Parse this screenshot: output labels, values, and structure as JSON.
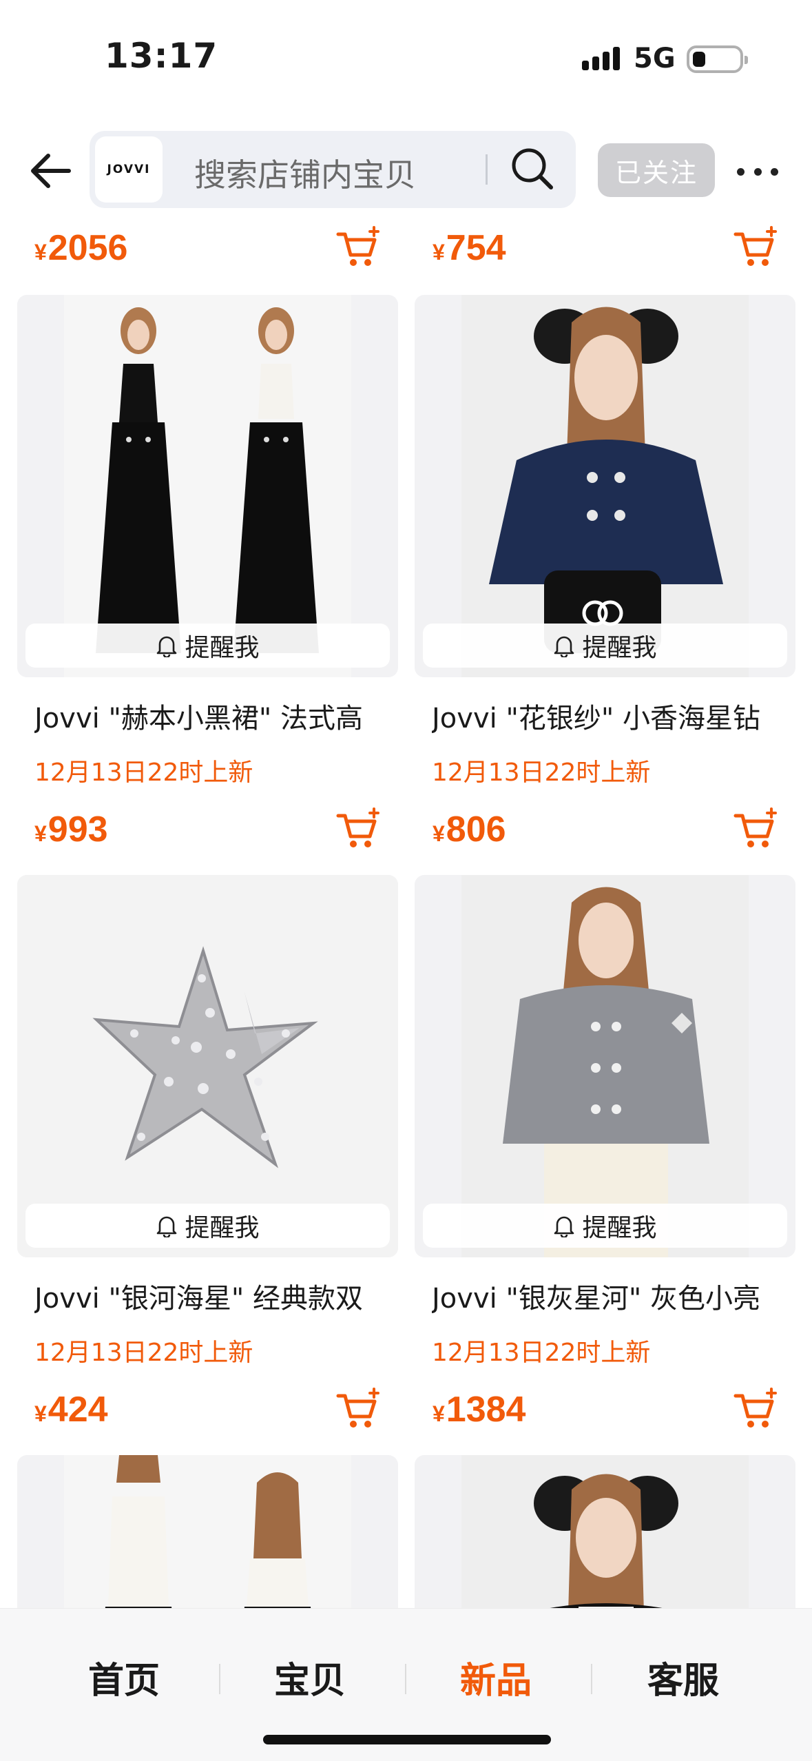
{
  "status_bar": {
    "time": "13:17",
    "network": "5G"
  },
  "header": {
    "shop_logo": "JOVVI",
    "search_placeholder": "搜索店铺内宝贝",
    "follow_label": "已关注"
  },
  "top_row": {
    "left_price": "2056",
    "right_price": "754",
    "currency": "¥"
  },
  "products": [
    {
      "title": "Jovvi \"赫本小黑裙\" 法式高",
      "launch": "12月13日22时上新",
      "price": "993",
      "remind": "提醒我"
    },
    {
      "title": "Jovvi \"花银纱\" 小香海星钻",
      "launch": "12月13日22时上新",
      "price": "806",
      "remind": "提醒我"
    },
    {
      "title": "Jovvi \"银河海星\" 经典款双",
      "launch": "12月13日22时上新",
      "price": "424",
      "remind": "提醒我"
    },
    {
      "title": "Jovvi \"银灰星河\" 灰色小亮",
      "launch": "12月13日22时上新",
      "price": "1384",
      "remind": "提醒我"
    }
  ],
  "tabbar": {
    "tabs": [
      "首页",
      "宝贝",
      "新品",
      "客服"
    ],
    "active": "新品"
  },
  "colors": {
    "accent": "#f15a0a",
    "follow_bg": "#cfcfd2",
    "search_bg": "#eef0f5"
  }
}
